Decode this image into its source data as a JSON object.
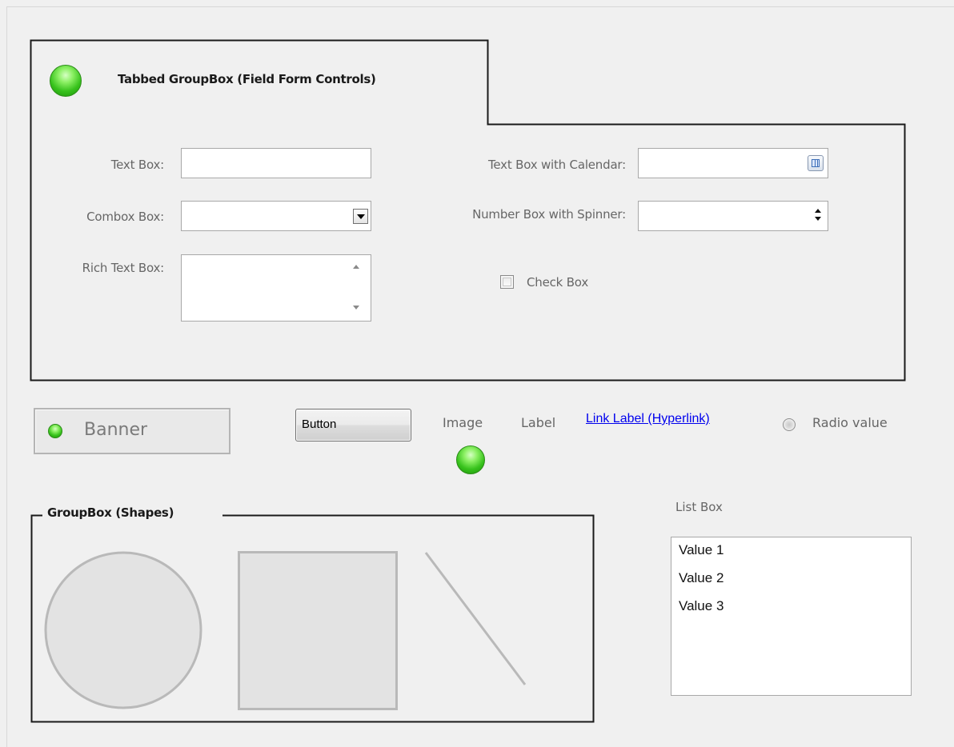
{
  "tabbed_groupbox": {
    "title": "Tabbed GroupBox (Field Form Controls)"
  },
  "fields": {
    "text_box": {
      "label": "Text Box:",
      "value": ""
    },
    "combo_box": {
      "label": "Combox Box:",
      "selected": ""
    },
    "rich_text_box": {
      "label": "Rich Text Box:",
      "value": ""
    },
    "calendar_box": {
      "label": "Text Box with Calendar:",
      "value": ""
    },
    "number_box": {
      "label": "Number Box with Spinner:",
      "value": ""
    },
    "check_box": {
      "label": "Check Box",
      "checked": false
    }
  },
  "banner": {
    "text": "Banner"
  },
  "button": {
    "label": "Button"
  },
  "image_label": "Image",
  "plain_label": "Label",
  "link_label": "Link Label (Hyperlink)",
  "radio": {
    "label": "Radio value",
    "selected": false
  },
  "shapes_groupbox": {
    "title": "GroupBox (Shapes)"
  },
  "list_box": {
    "label": "List Box",
    "items": [
      "Value 1",
      "Value 2",
      "Value 3"
    ]
  },
  "colors": {
    "background": "#f0f0f0",
    "status_green": "#37c21c",
    "link": "#0000ee",
    "shape_stroke": "#b9b9b9",
    "shape_fill": "#e3e3e3"
  },
  "icons": [
    "green-status-orb-icon",
    "dropdown-arrow-icon",
    "calendar-icon",
    "spinner-arrows-icon",
    "scroll-up-icon",
    "scroll-down-icon"
  ]
}
